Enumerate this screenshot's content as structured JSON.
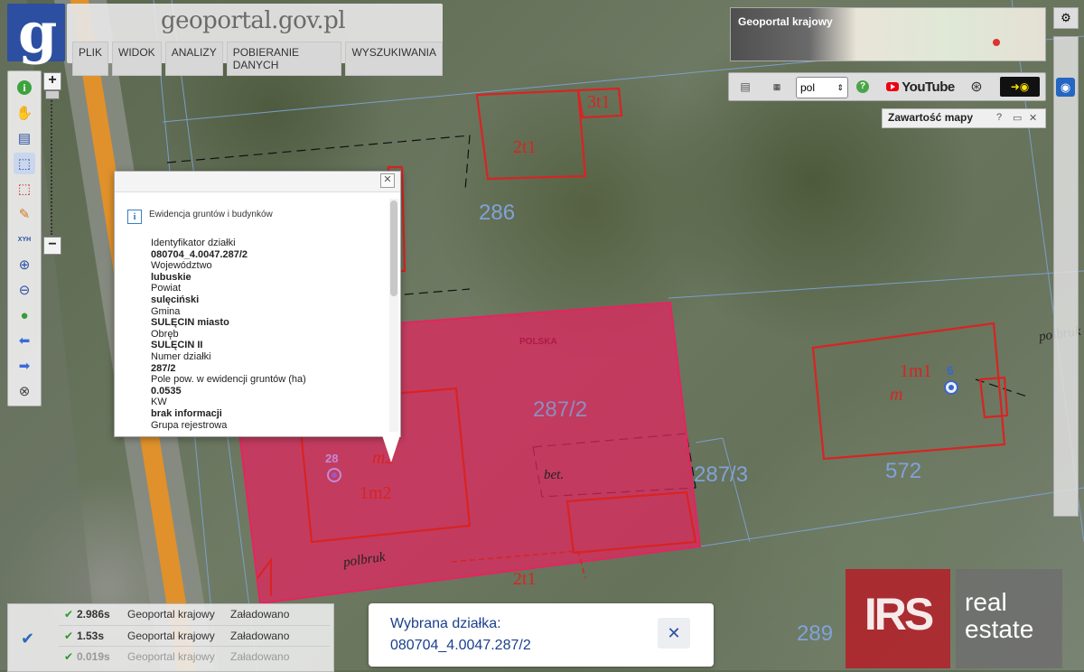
{
  "header": {
    "site_title": "geoportal.gov.pl",
    "logo_letter": "g",
    "menu": [
      "PLIK",
      "WIDOK",
      "ANALIZY",
      "POBIERANIE DANYCH",
      "WYSZUKIWANIA"
    ]
  },
  "overview": {
    "title": "Geoportal krajowy"
  },
  "icons_bar": {
    "language": "pol",
    "youtube": "YouTube"
  },
  "map_content": {
    "title": "Zawartość mapy",
    "help": "?"
  },
  "map_labels": {
    "parcel_286": "286",
    "parcel_287_2": "287/2",
    "parcel_287_3": "287/3",
    "parcel_572": "572",
    "parcel_289": "289",
    "bld_2t1_top": "2t1",
    "bld_3t1": "3t1",
    "bld_1m1": "1m1",
    "bld_m": "m",
    "bld_1m2": "1m2",
    "bld_m2": "m2",
    "bld_2t1_bottom": "2t1",
    "bet": "bet.",
    "polbruk_left": "polbruk",
    "polbruk_right": "polbruk",
    "point_6": "6",
    "point_28": "28",
    "polska": "POLSKA"
  },
  "popup": {
    "title": "Ewidencja gruntów i budynków",
    "fields": [
      {
        "label": "Identyfikator działki",
        "value": "080704_4.0047.287/2"
      },
      {
        "label": "Województwo",
        "value": "lubuskie"
      },
      {
        "label": "Powiat",
        "value": "sulęciński"
      },
      {
        "label": "Gmina",
        "value": "SULĘCIN miasto"
      },
      {
        "label": "Obręb",
        "value": "SULĘCIN II"
      },
      {
        "label": "Numer działki",
        "value": "287/2"
      },
      {
        "label": "Pole pow. w ewidencji gruntów (ha)",
        "value": "0.0535"
      },
      {
        "label": "KW",
        "value": "brak informacji"
      },
      {
        "label": "Grupa rejestrowa",
        "value": ""
      }
    ]
  },
  "status": {
    "rows": [
      {
        "time": "2.986s",
        "name": "Geoportal krajowy",
        "state": "Załadowano"
      },
      {
        "time": "1.53s",
        "name": "Geoportal krajowy",
        "state": "Załadowano"
      },
      {
        "time": "0.019s",
        "name": "Geoportal krajowy",
        "state": "Załadowano"
      }
    ]
  },
  "selected_parcel": {
    "label": "Wybrana działka:",
    "value": "080704_4.0047.287/2"
  },
  "watermark": {
    "irs": "IRS",
    "line1": "real",
    "line2": "estate"
  },
  "colors": {
    "accent": "#2c4fa2",
    "parcel_fill": "#e5245f",
    "building": "#d92323",
    "parcel_line": "#6f9bd6"
  }
}
